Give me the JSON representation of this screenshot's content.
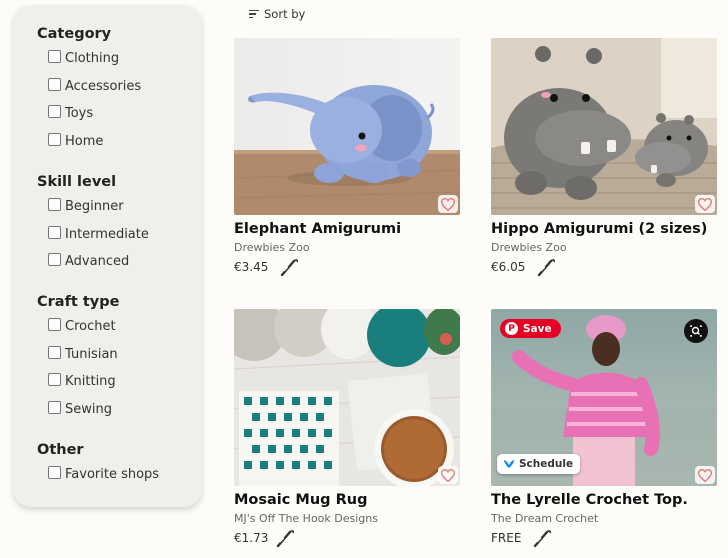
{
  "filters": {
    "groups": [
      {
        "title": "Category",
        "options": [
          "Clothing",
          "Accessories",
          "Toys",
          "Home"
        ]
      },
      {
        "title": "Skill level",
        "options": [
          "Beginner",
          "Intermediate",
          "Advanced"
        ]
      },
      {
        "title": "Craft type",
        "options": [
          "Crochet",
          "Tunisian",
          "Knitting",
          "Sewing"
        ]
      },
      {
        "title": "Other",
        "options": [
          "Favorite shops"
        ]
      }
    ]
  },
  "toolbar": {
    "sort_label": "Sort by"
  },
  "products": [
    {
      "title": "Elephant Amigurumi",
      "shop": "Drewbies Zoo",
      "price": "€3.45"
    },
    {
      "title": "Hippo Amigurumi (2 sizes)",
      "shop": "Drewbies Zoo",
      "price": "€6.05"
    },
    {
      "title": "Mosaic Mug Rug",
      "shop": "MJ's Off The Hook Designs",
      "price": "€1.73"
    },
    {
      "title": "The Lyrelle Crochet Top.",
      "shop": "The Dream Crochet",
      "price": "FREE"
    }
  ],
  "overlays": {
    "pin_save_label": "Save",
    "schedule_label": "Schedule"
  },
  "colors": {
    "accent_heart": "#e6766e",
    "pinterest": "#e60023",
    "panel": "#f0efeb"
  }
}
